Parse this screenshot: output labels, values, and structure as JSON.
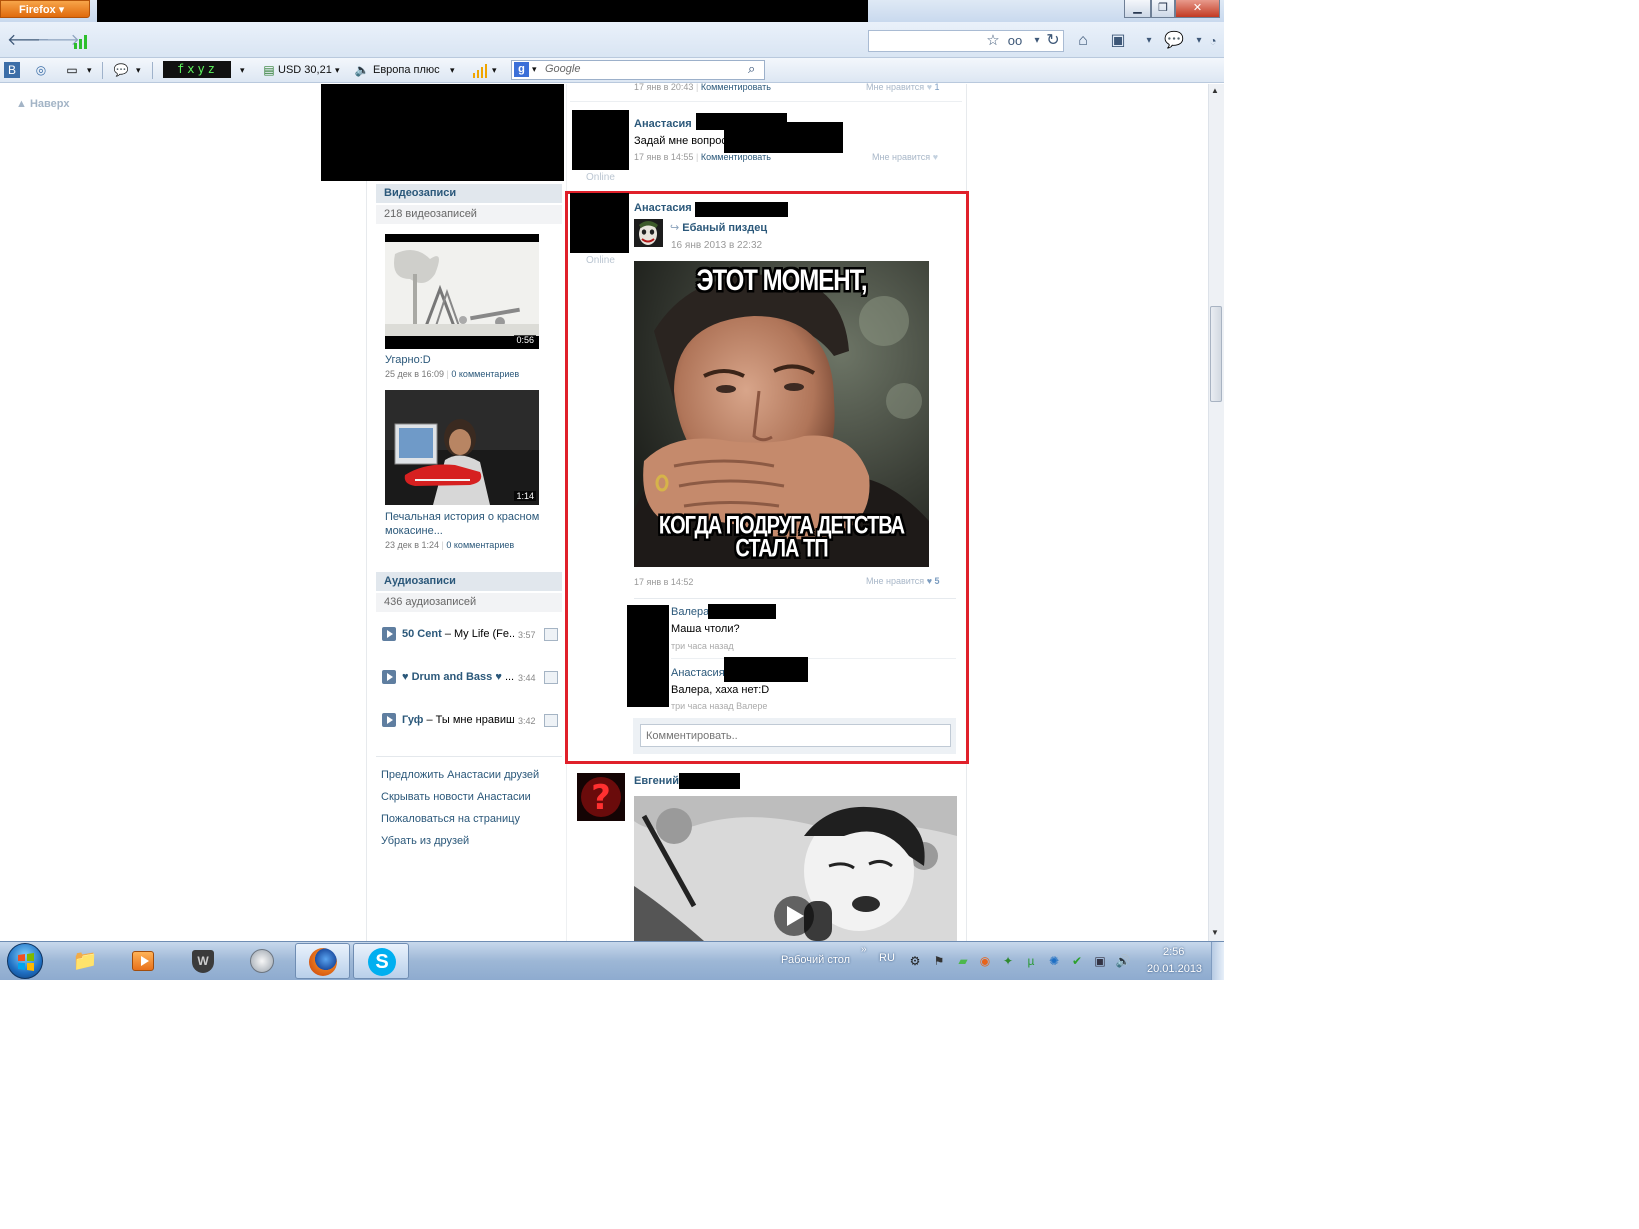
{
  "browser": {
    "menu_label": "Firefox",
    "window_buttons": {
      "minimize": "▁",
      "maximize": "❐",
      "close": "✕"
    },
    "nav_icons": [
      "back-icon",
      "forward-icon",
      "signal-bars-icon"
    ],
    "toolbar": {
      "currency": "USD 30,21",
      "radio": "Европа плюс",
      "fxyz": "fxyz",
      "search_placeholder": "Google",
      "search_engine_letter": "g"
    }
  },
  "page": {
    "back_to_top": "Наверх",
    "colors": {
      "link": "#2b587a",
      "highlight": "#e0202a"
    },
    "videos": {
      "title": "Видеозаписи",
      "count": "218 видеозаписей",
      "items": [
        {
          "title": "Угарно:D",
          "date": "25 дек в 16:09",
          "comments": "0 комментариев",
          "duration": "0:56"
        },
        {
          "title": "Печальная история о красном мокасине...",
          "date": "23 дек в 1:24",
          "comments": "0 комментариев",
          "duration": "1:14"
        }
      ]
    },
    "audio": {
      "title": "Аудиозаписи",
      "count": "436 аудиозаписей",
      "items": [
        {
          "artist": "50 Cent",
          "track": "– My Life (Fe...",
          "duration": "3:57"
        },
        {
          "artist": "♥ Drum and Bass ♥",
          "track": "...",
          "duration": "3:44"
        },
        {
          "artist": "Гуф",
          "track": "– Ты мне нравиш...",
          "duration": "3:42"
        }
      ]
    },
    "profile_actions": [
      "Предложить Анастасии друзей",
      "Скрывать новости Анастасии",
      "Пожаловаться на страницу",
      "Убрать из друзей"
    ],
    "feed": {
      "top_item": {
        "date": "17 янв в 20:43",
        "comment_link": "Комментировать",
        "like_label": "Мне нравится",
        "like_count": "1"
      },
      "post1": {
        "author": "Анастасия",
        "text": "Задай мне вопрос",
        "date": "17 янв в 14:55",
        "comment_link": "Комментировать",
        "like_label": "Мне нравится",
        "status": "Online"
      },
      "post2": {
        "author": "Анастасия",
        "status": "Online",
        "repost_group": "Ебаный пиздец",
        "repost_date": "16 янв 2013 в 22:32",
        "meme_top": "ЭТОТ МОМЕНТ,",
        "meme_bottom_1": "КОГДА ПОДРУГА ДЕТСТВА",
        "meme_bottom_2": "СТАЛА ТП",
        "date": "17 янв в 14:52",
        "like_label": "Мне нравится",
        "like_count": "5",
        "comments": [
          {
            "author": "Валера",
            "text": "Маша чтоли?",
            "meta": "три часа назад"
          },
          {
            "author": "Анастасия",
            "text": "Валера, хаха нет:D",
            "meta": "три часа назад Валере"
          }
        ],
        "comment_placeholder": "Комментировать.."
      },
      "post3": {
        "author": "Евгений"
      }
    }
  },
  "taskbar": {
    "desktop_label": "Рабочий стол",
    "lang": "RU",
    "time": "2:56",
    "date": "20.01.2013",
    "apps": [
      "explorer-icon",
      "media-player-icon",
      "world-of-tanks-icon",
      "speaker-app-icon",
      "firefox-icon",
      "skype-icon"
    ]
  }
}
